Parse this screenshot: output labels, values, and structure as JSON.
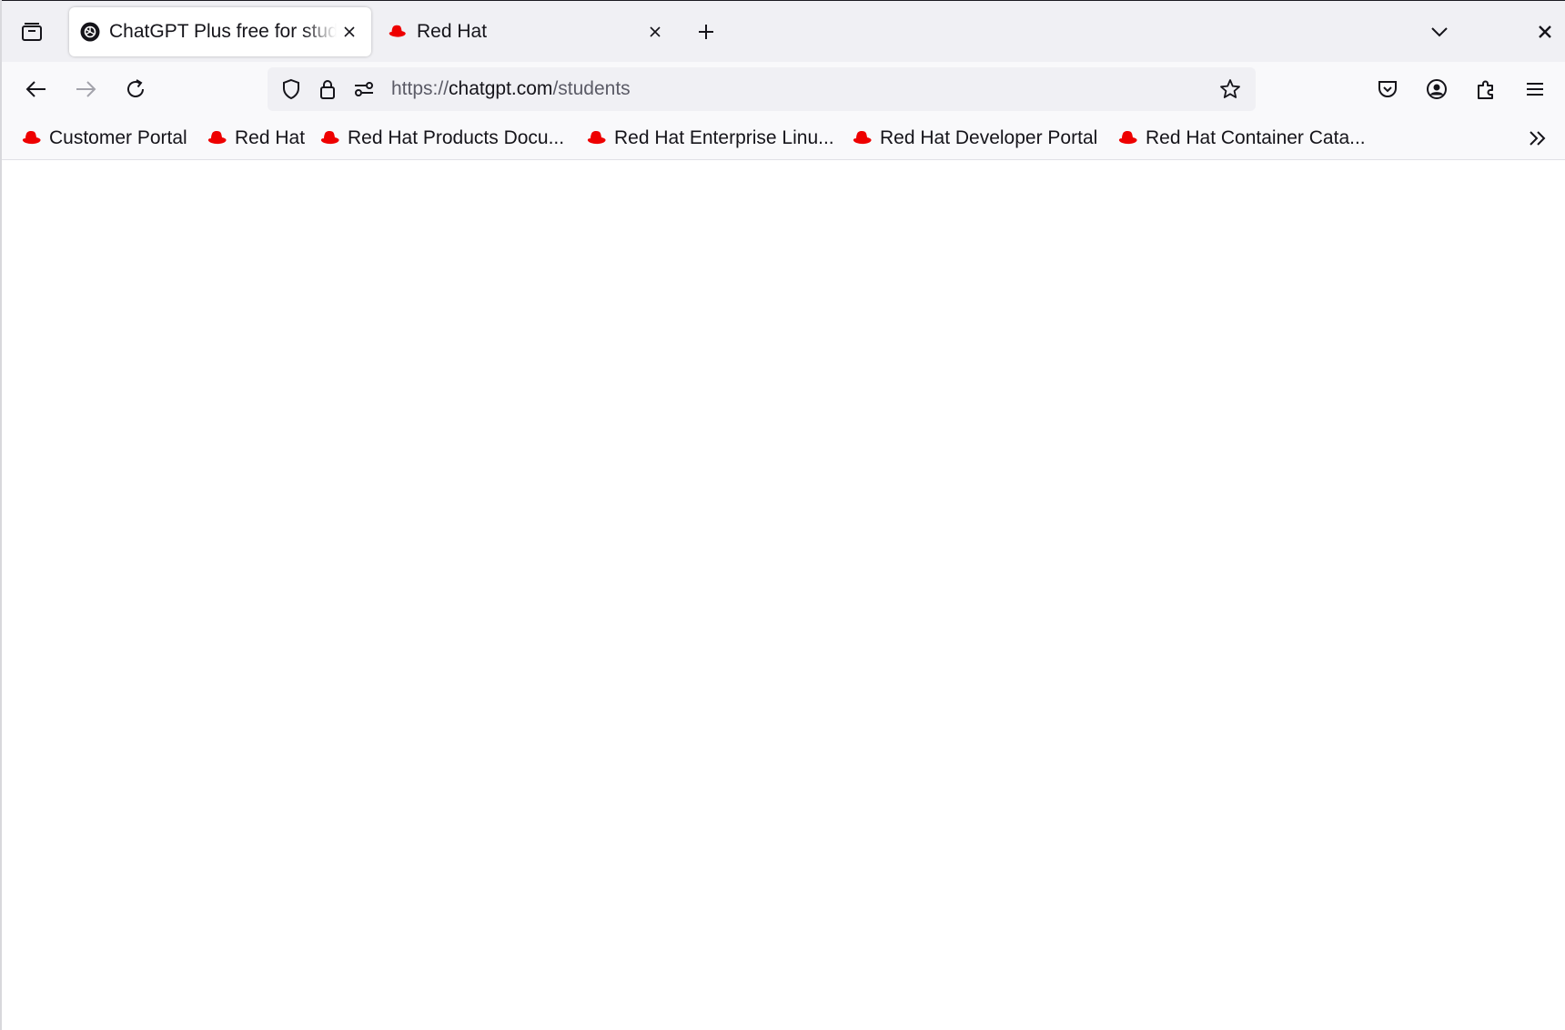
{
  "tabs": [
    {
      "title": "ChatGPT Plus free for students",
      "favicon": "openai-icon",
      "active": true
    },
    {
      "title": "Red Hat",
      "favicon": "redhat-icon",
      "active": false
    }
  ],
  "url": {
    "scheme": "https://",
    "host": "chatgpt.com",
    "path": "/students"
  },
  "bookmarks": [
    {
      "label": "Customer Portal",
      "icon": "redhat-icon"
    },
    {
      "label": "Red Hat",
      "icon": "redhat-icon"
    },
    {
      "label": "Red Hat Products Docu...",
      "icon": "redhat-icon"
    },
    {
      "label": "Red Hat Enterprise Linu...",
      "icon": "redhat-icon"
    },
    {
      "label": "Red Hat Developer Portal",
      "icon": "redhat-icon"
    },
    {
      "label": "Red Hat Container Cata...",
      "icon": "redhat-icon"
    }
  ],
  "colors": {
    "redhat_red": "#ee0000",
    "tabstrip_bg": "#f0f0f4",
    "toolbar_bg": "#f9f9fb"
  }
}
